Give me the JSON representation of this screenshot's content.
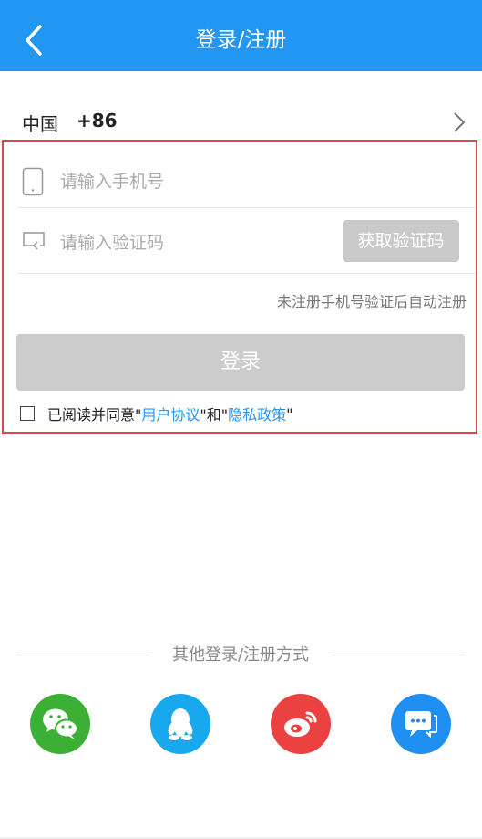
{
  "header": {
    "title": "登录/注册"
  },
  "country": {
    "name": "中国",
    "code": "+86"
  },
  "form": {
    "phone_placeholder": "请输入手机号",
    "code_placeholder": "请输入验证码",
    "get_code_label": "获取验证码",
    "hint": "未注册手机号验证后自动注册",
    "login_label": "登录",
    "agree_prefix": "已阅读并同意\"",
    "agree_link1": "用户协议",
    "agree_mid": "\"和\"",
    "agree_link2": "隐私政策",
    "agree_suffix": "\""
  },
  "other_login": {
    "label": "其他登录/注册方式",
    "methods": [
      {
        "icon": "wechat-icon",
        "color": "#3cb035"
      },
      {
        "icon": "qq-icon",
        "color": "#17a8ee"
      },
      {
        "icon": "weibo-icon",
        "color": "#ec4141"
      },
      {
        "icon": "sms-icon",
        "color": "#1f8ff2"
      }
    ]
  },
  "colors": {
    "primary": "#2196f3",
    "highlight_border": "#d94a4f",
    "disabled": "#cccccc"
  }
}
